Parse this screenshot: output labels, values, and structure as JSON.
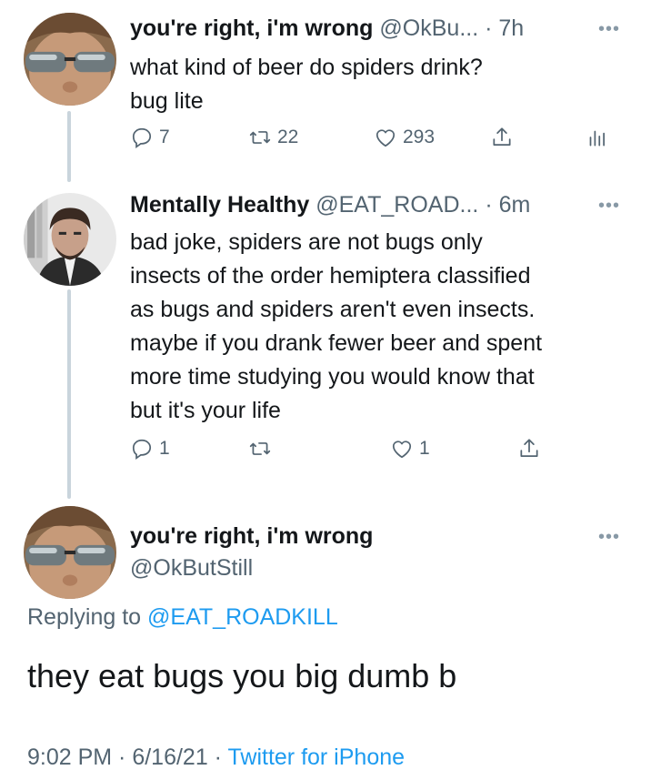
{
  "tweets": [
    {
      "name": "you're right, i'm wrong",
      "handle": "@OkBu...",
      "time": "· 7h",
      "text_lines": [
        "what kind of beer do spiders drink?",
        "bug lite"
      ],
      "reply_count": "7",
      "retweet_count": "22",
      "like_count": "293"
    },
    {
      "name": "Mentally Healthy",
      "handle": "@EAT_ROAD...",
      "time": "· 6m",
      "text_lines": [
        "bad joke, spiders are not bugs only",
        "insects of the order hemiptera classified",
        "as bugs and spiders aren't even insects.",
        "maybe if you drank fewer beer and spent",
        "more time studying you would know that",
        "but it's your life"
      ],
      "reply_count": "1",
      "retweet_count": "",
      "like_count": "1"
    }
  ],
  "main_tweet": {
    "name": "you're right, i'm wrong",
    "handle": "@OkButStill",
    "replying_prefix": "Replying to ",
    "replying_to": "@EAT_ROADKILL",
    "text": "they eat bugs you big dumb b",
    "timestamp": "9:02 PM · 6/16/21 · ",
    "source": "Twitter for iPhone"
  },
  "colors": {
    "link": "#1d9bf0",
    "muted": "#536471",
    "thread_line": "#c9d4dc"
  },
  "icons": [
    "more-options-icon",
    "reply-icon",
    "retweet-icon",
    "like-icon",
    "share-icon",
    "analytics-icon"
  ]
}
